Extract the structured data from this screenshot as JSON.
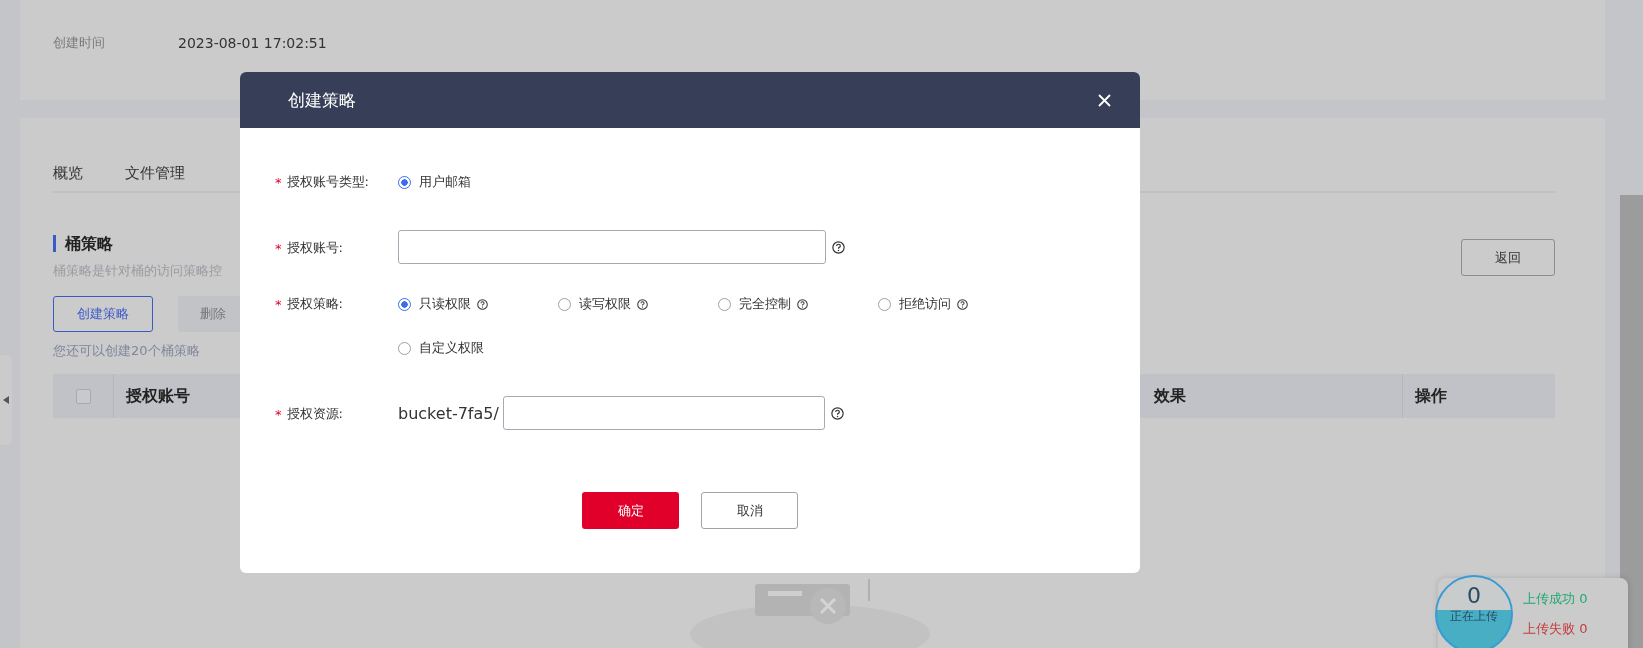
{
  "info": {
    "label": "创建时间",
    "value": "2023-08-01 17:02:51"
  },
  "tabs": [
    {
      "label": "概览",
      "selected": false
    },
    {
      "label": "文件管理",
      "selected": false
    }
  ],
  "section": {
    "title": "桶策略",
    "description": "桶策略是针对桶的访问策略控",
    "back": "返回",
    "quota": "您还可以创建20个桶策略",
    "buttons": [
      {
        "label": "创建策略",
        "kind": "outline"
      },
      {
        "label": "删除",
        "kind": "disabled"
      }
    ]
  },
  "table": {
    "select_all": {
      "checked": false
    },
    "columns": [
      {
        "label": "授权账号",
        "kind": "first"
      },
      {
        "label": "效果",
        "kind": "cut"
      },
      {
        "label": "操作",
        "kind": "last"
      }
    ]
  },
  "dialog": {
    "title": "创建策略",
    "fields": [
      {
        "kind": "radio",
        "label": "授权账号类型:",
        "mark": "*",
        "options": [
          {
            "label": "用户邮箱",
            "selected": true,
            "help": false
          }
        ]
      },
      {
        "kind": "input",
        "label": "授权账号:",
        "mark": "*",
        "help": true
      },
      {
        "kind": "radio",
        "label": "授权策略:",
        "mark": "*",
        "options": [
          {
            "label": "只读权限",
            "selected": true,
            "help": true
          },
          {
            "label": "读写权限",
            "selected": false,
            "help": true
          },
          {
            "label": "完全控制",
            "selected": false,
            "help": true
          },
          {
            "label": "拒绝访问",
            "selected": false,
            "help": true
          },
          {
            "label": "自定义权限",
            "selected": false,
            "help": false
          }
        ]
      },
      {
        "kind": "input",
        "label": "授权资源:",
        "mark": "*",
        "prefix": "bucket-7fa5/",
        "help": true
      }
    ],
    "buttons": [
      {
        "label": "确定",
        "kind": "primary"
      },
      {
        "label": "取消",
        "kind": "secondary"
      }
    ]
  },
  "upload": {
    "count": "0",
    "label": "正在上传",
    "success": "上传成功 0",
    "failed": "上传失败 0"
  }
}
